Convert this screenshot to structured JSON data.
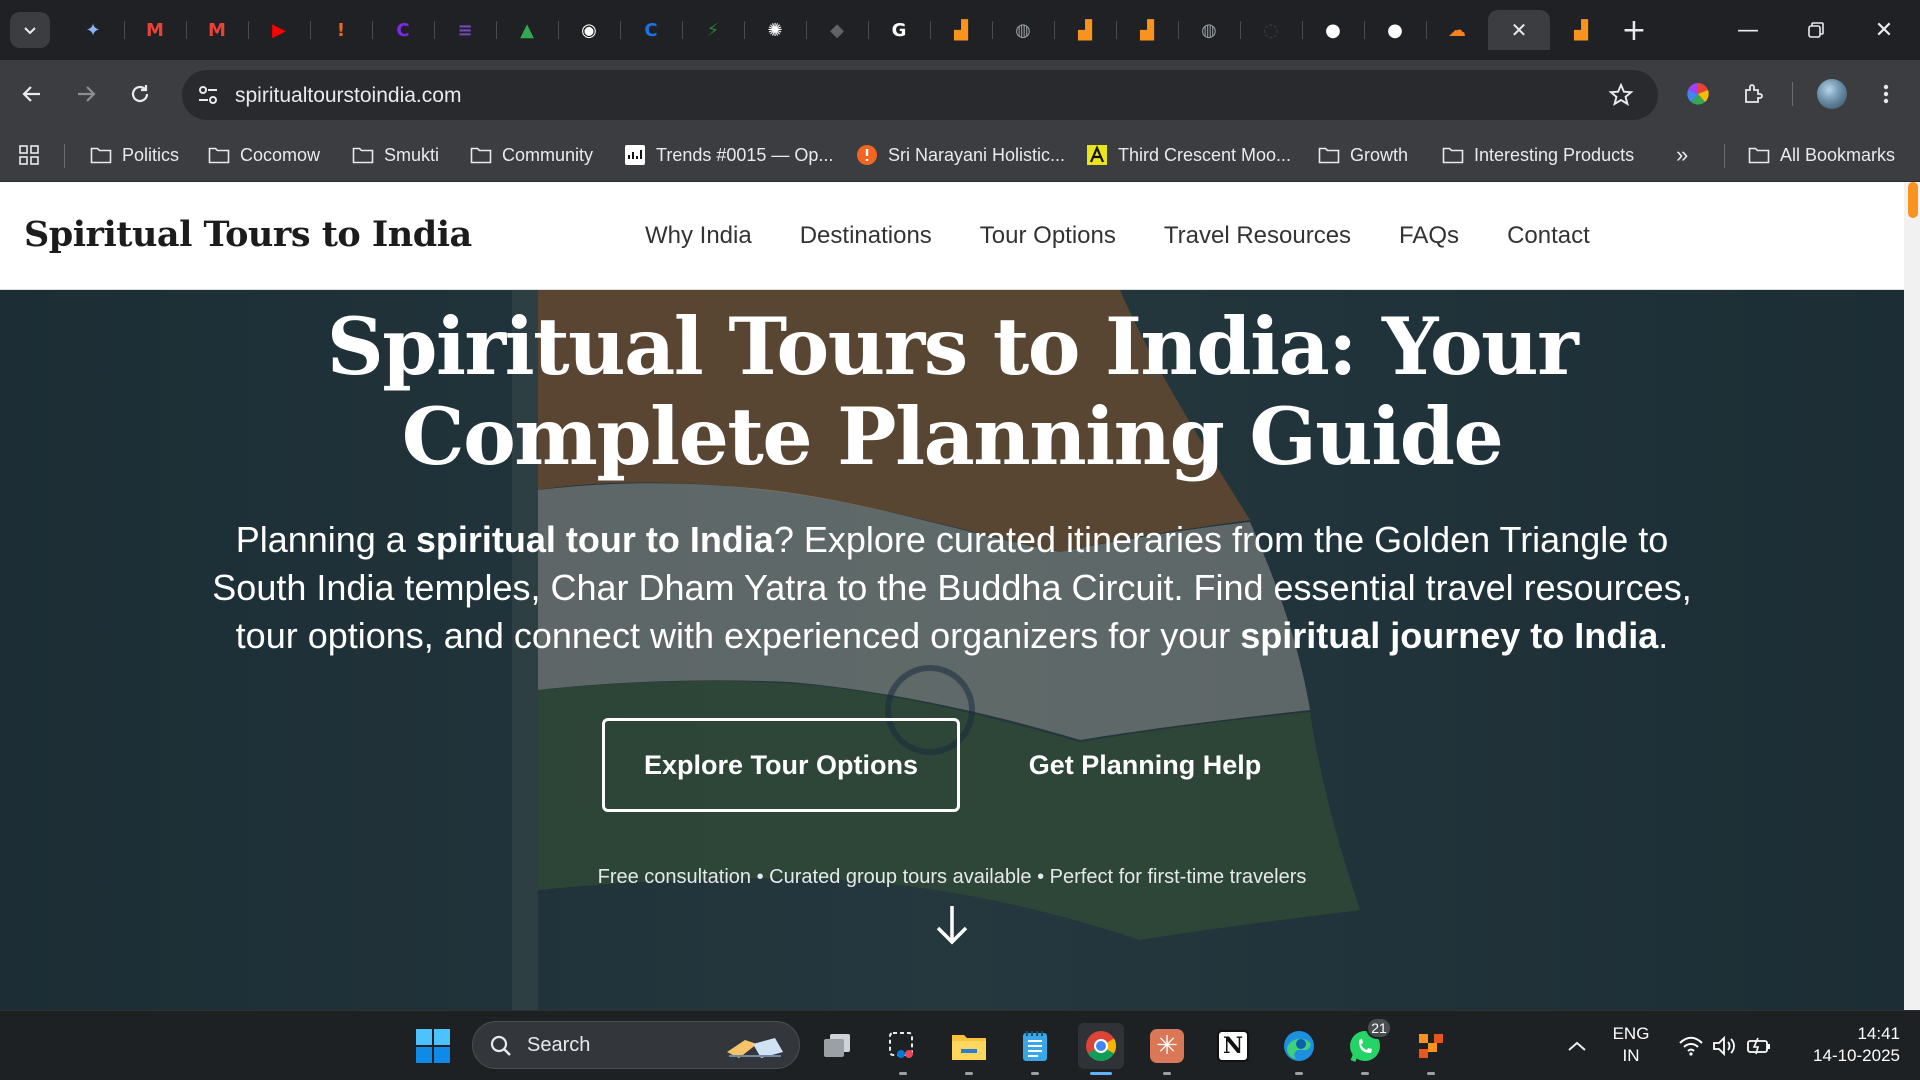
{
  "browser": {
    "tabs": [
      {
        "icon": "gemini-icon",
        "color": "#8ab4f8",
        "glyph": "✦"
      },
      {
        "icon": "gmail-icon",
        "color": "#ea4335",
        "glyph": "M"
      },
      {
        "icon": "gmail-icon",
        "color": "#ea4335",
        "glyph": "M"
      },
      {
        "icon": "youtube-icon",
        "color": "#ff0000",
        "glyph": "▶"
      },
      {
        "icon": "narayani-icon",
        "color": "#f26522",
        "glyph": "!"
      },
      {
        "icon": "canva-icon",
        "color": "#7d2ae8",
        "glyph": "C"
      },
      {
        "icon": "forms-icon",
        "color": "#7248b9",
        "glyph": "≡"
      },
      {
        "icon": "drive-icon",
        "color": "#34a853",
        "glyph": "▲"
      },
      {
        "icon": "podcast-icon",
        "color": "#ffffff",
        "glyph": "◉"
      },
      {
        "icon": "app-icon",
        "color": "#1a73e8",
        "glyph": "C"
      },
      {
        "icon": "bolt-icon",
        "color": "#2e7d32",
        "glyph": "⚡"
      },
      {
        "icon": "openai-icon",
        "color": "#ffffff",
        "glyph": "✺"
      },
      {
        "icon": "app-icon",
        "color": "#5f6368",
        "glyph": "◆"
      },
      {
        "icon": "google-icon",
        "color": "#ffffff",
        "glyph": "G"
      },
      {
        "icon": "brand-icon",
        "color": "#f7931e",
        "glyph": "▟"
      },
      {
        "icon": "globe-icon",
        "color": "#9aa0a6",
        "glyph": "◍"
      },
      {
        "icon": "brand-icon",
        "color": "#f7931e",
        "glyph": "▟"
      },
      {
        "icon": "brand-icon",
        "color": "#f7931e",
        "glyph": "▟"
      },
      {
        "icon": "globe-icon",
        "color": "#9aa0a6",
        "glyph": "◍"
      },
      {
        "icon": "app-icon",
        "color": "#3c4043",
        "glyph": "◌"
      },
      {
        "icon": "github-icon",
        "color": "#ffffff",
        "glyph": "●"
      },
      {
        "icon": "github-icon",
        "color": "#ffffff",
        "glyph": "●"
      },
      {
        "icon": "cloudflare-icon",
        "color": "#f6821f",
        "glyph": "☁"
      },
      {
        "icon": "close-icon",
        "color": "#e8eaed",
        "glyph": "✕",
        "active": true
      },
      {
        "icon": "brand-icon",
        "color": "#f7931e",
        "glyph": "▟"
      }
    ],
    "url": "spiritualtourstoindia.com",
    "bookmarks": {
      "items": [
        {
          "label": "Politics",
          "icon": "folder-icon"
        },
        {
          "label": "Cocomow",
          "icon": "folder-icon"
        },
        {
          "label": "Smukti",
          "icon": "folder-icon"
        },
        {
          "label": "Community",
          "icon": "folder-icon"
        },
        {
          "label": "Trends #0015 — Op...",
          "icon": "trends-icon"
        },
        {
          "label": "Sri Narayani Holistic...",
          "icon": "narayani-icon"
        },
        {
          "label": "Third Crescent Moo...",
          "icon": "letter-a-icon"
        },
        {
          "label": "Growth",
          "icon": "folder-icon"
        },
        {
          "label": "Interesting Products",
          "icon": "folder-icon"
        }
      ],
      "overflow": "»",
      "all_label": "All Bookmarks"
    }
  },
  "site": {
    "logo": "Spiritual Tours to India",
    "nav": [
      "Why India",
      "Destinations",
      "Tour Options",
      "Travel Resources",
      "FAQs",
      "Contact"
    ],
    "hero": {
      "title": "Spiritual Tours to India: Your Complete Planning Guide",
      "sub_1": "Planning a ",
      "sub_bold_1": "spiritual tour to India",
      "sub_2": "? Explore curated itineraries from the Golden Triangle to South India temples, Char Dham Yatra to the Buddha Circuit. Find essential travel resources, tour options, and connect with experienced organizers for your ",
      "sub_bold_2": "spiritual journey to India",
      "sub_3": ".",
      "primary_button": "Explore Tour Options",
      "secondary_button": "Get Planning Help",
      "note": "Free consultation • Curated group tours available • Perfect for first-time travelers"
    },
    "accent": "#f7931e"
  },
  "taskbar": {
    "search_label": "Search",
    "whatsapp_badge": "21",
    "lang_1": "ENG",
    "lang_2": "IN",
    "time": "14:41",
    "date": "14-10-2025"
  }
}
